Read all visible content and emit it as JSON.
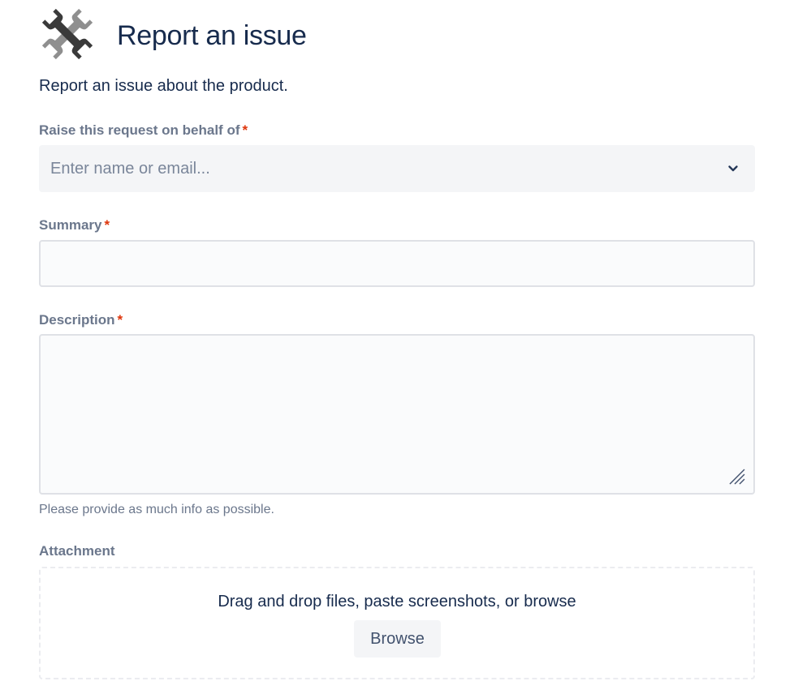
{
  "header": {
    "icon": "wrench-tools-icon",
    "title": "Report an issue"
  },
  "subtitle": "Report an issue about the product.",
  "fields": {
    "on_behalf": {
      "label": "Raise this request on behalf of",
      "required_mark": "*",
      "placeholder": "Enter name or email...",
      "icon": "chevron-down-icon"
    },
    "summary": {
      "label": "Summary",
      "required_mark": "*",
      "value": ""
    },
    "description": {
      "label": "Description",
      "required_mark": "*",
      "value": "",
      "helper": "Please provide as much info as possible."
    },
    "attachment": {
      "label": "Attachment",
      "dropzone_text": "Drag and drop files, paste screenshots, or browse",
      "browse_label": "Browse"
    }
  },
  "colors": {
    "text": "#172B4D",
    "label": "#6B778C",
    "required": "#DE350B",
    "field_bg": "#F4F5F7",
    "input_bg": "#FAFBFC",
    "border": "#DFE1E6"
  }
}
